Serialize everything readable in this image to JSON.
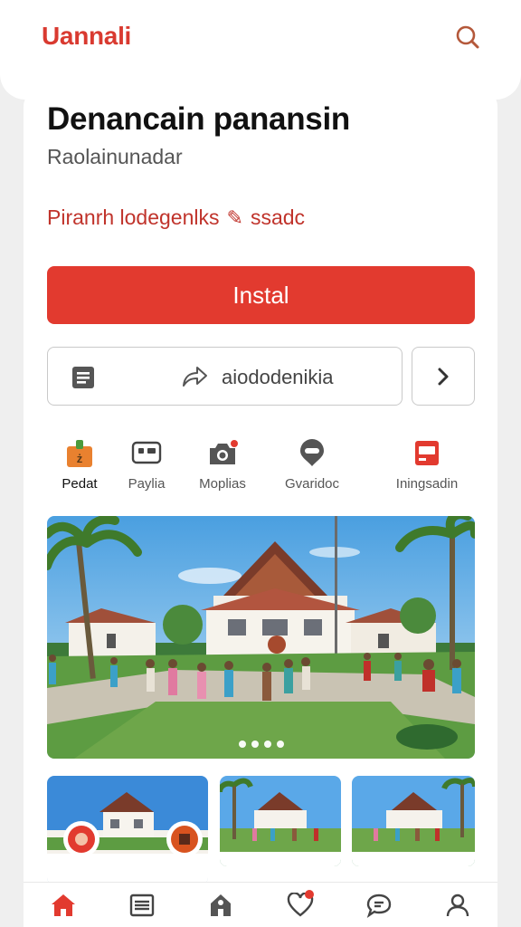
{
  "header": {
    "brand": "Uannali",
    "search_icon": "search-icon"
  },
  "app": {
    "title": "Denancain panansin",
    "subtitle": "Raolainunadar",
    "tag": "Piranrh lodegenlks",
    "tag_suffix": "ssadc"
  },
  "actions": {
    "install_label": "Instal",
    "share_label": "aiododenikia",
    "next_icon": "chevron-right-icon"
  },
  "categories": [
    {
      "label": "Pedat",
      "icon": "gift-icon"
    },
    {
      "label": "Paylia",
      "icon": "card-icon"
    },
    {
      "label": "Moplias",
      "icon": "camera-icon"
    },
    {
      "label": "Gvaridoc",
      "icon": "chat-icon"
    },
    {
      "label": "Iningsadin",
      "icon": "box-icon"
    }
  ],
  "gallery": {
    "slides": 4,
    "active_slide": 1
  },
  "bottom_nav": [
    {
      "icon": "home-icon"
    },
    {
      "icon": "list-icon"
    },
    {
      "icon": "tag-icon"
    },
    {
      "icon": "heart-icon",
      "badge": true
    },
    {
      "icon": "message-icon"
    },
    {
      "icon": "profile-icon"
    }
  ],
  "colors": {
    "accent": "#e23a2f",
    "brand": "#d93a30"
  }
}
